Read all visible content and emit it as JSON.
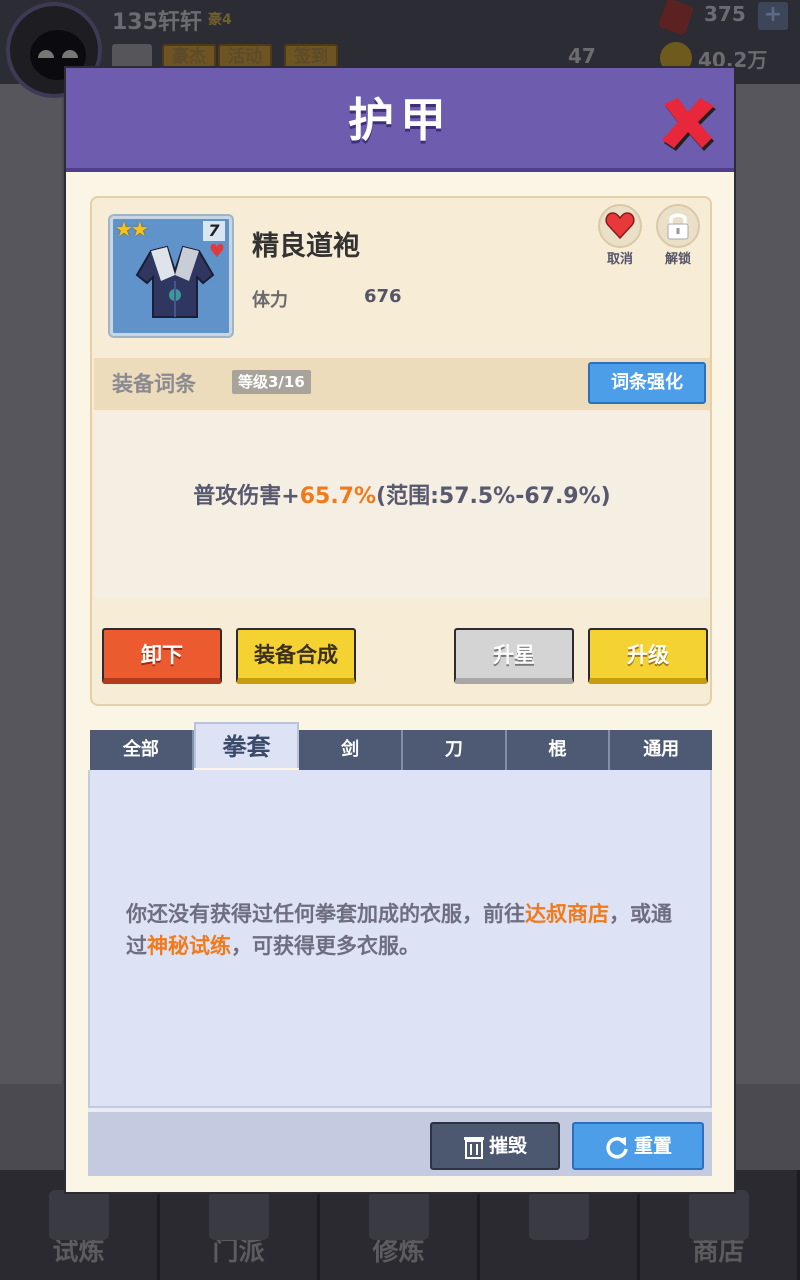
{
  "hud": {
    "player_name": "135轩轩",
    "vip_label": "豪4",
    "buttons": [
      "豪杰",
      "活动",
      "签到"
    ],
    "gems": "375",
    "stat_count": "47",
    "gold": "40.2万"
  },
  "bottom_nav": [
    "试炼",
    "门派",
    "修炼",
    "",
    "商店"
  ],
  "modal": {
    "title": "护甲",
    "item": {
      "name": "精良道袍",
      "level": "7",
      "stat_label": "体力",
      "stat_value": "676",
      "cancel_label": "取消",
      "unlock_label": "解锁"
    },
    "affix": {
      "title": "装备词条",
      "level": "等级3/16",
      "enhance_label": "词条强化",
      "line_prefix": "普攻伤害+",
      "line_value": "65.7%",
      "line_range": "(范围:57.5%-67.9%)"
    },
    "actions": {
      "unequip": "卸下",
      "synthesize": "装备合成",
      "star_up": "升星",
      "upgrade": "升级"
    },
    "tabs": [
      "全部",
      "拳套",
      "剑",
      "刀",
      "棍",
      "通用"
    ],
    "active_tab": "拳套",
    "empty_message": {
      "part1": "你还没有获得过任何拳套加成的衣服，前往",
      "link1": "达叔商店",
      "part2": "，或通过",
      "link2": "神秘试练",
      "part3": "，可获得更多衣服。"
    },
    "footer": {
      "destroy_label": "摧毁",
      "reset_label": "重置"
    }
  },
  "colors": {
    "header": "#6e5cae",
    "accent_blue": "#4c9ee8",
    "highlight_orange": "#f07a1c",
    "button_red": "#ec5a30",
    "button_yellow": "#f4d232"
  }
}
